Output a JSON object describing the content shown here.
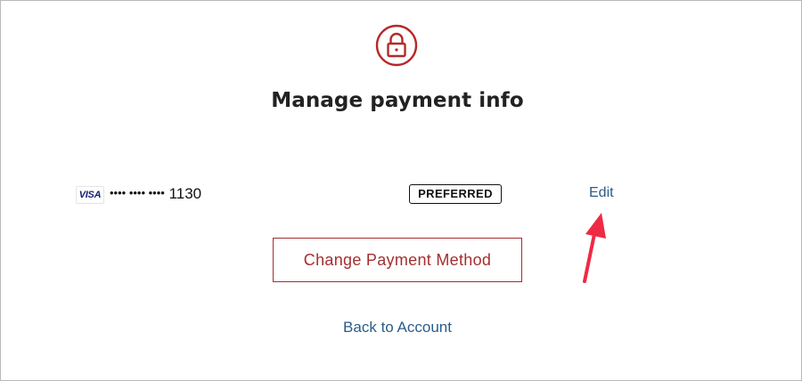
{
  "header": {
    "icon": "lock-icon",
    "icon_color": "#b5292a",
    "title": "Manage payment info"
  },
  "payment_method": {
    "card_brand": "VISA",
    "card_brand_color": "#1a1f71",
    "masked_number": "•••• •••• ••••",
    "last_four": "1130",
    "status_badge": "PREFERRED",
    "edit_label": "Edit"
  },
  "annotation": {
    "icon": "arrow-icon",
    "color": "#ee2a45"
  },
  "actions": {
    "change_label": "Change Payment Method",
    "change_color": "#a42e2e",
    "back_label": "Back to Account",
    "link_color": "#2a5c8a"
  }
}
